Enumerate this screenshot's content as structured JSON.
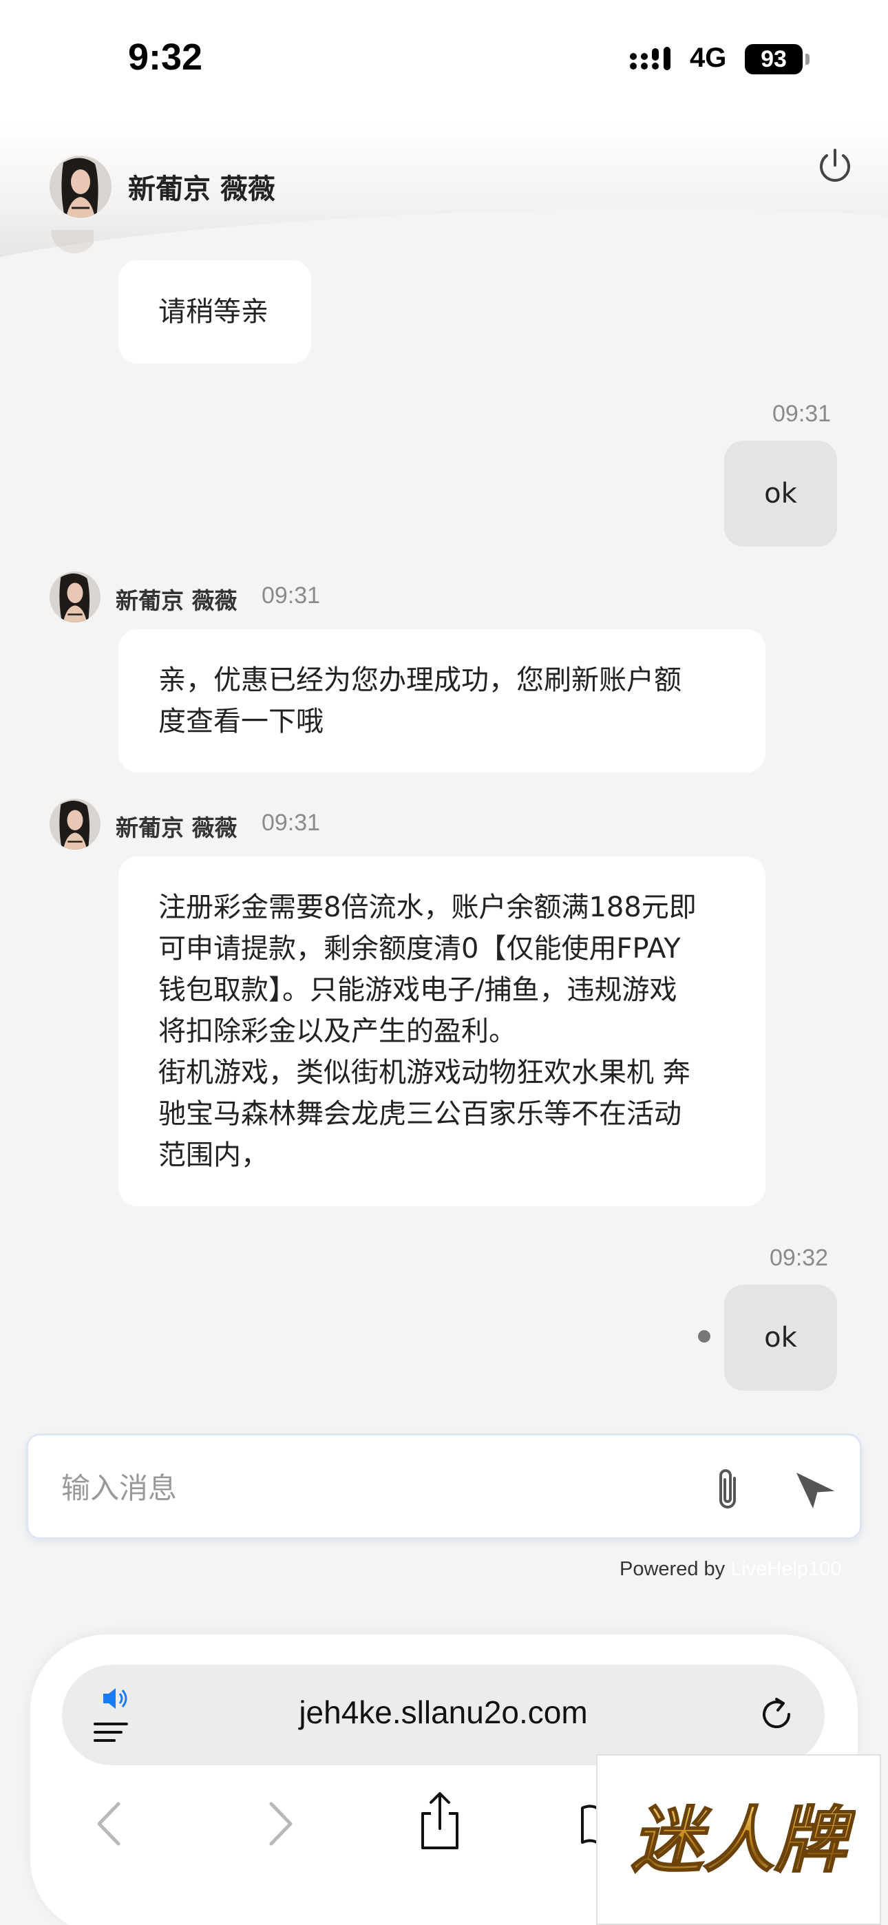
{
  "status_bar": {
    "time": "9:32",
    "network": "4G",
    "battery": "93"
  },
  "header": {
    "title": "新葡京 薇薇",
    "avatar_icon": "avatar-icon",
    "power_icon": "power-icon"
  },
  "messages": [
    {
      "direction": "in",
      "text": "请稍等亲"
    },
    {
      "direction": "out",
      "time": "09:31",
      "text": "ok"
    },
    {
      "direction": "in",
      "sender": "新葡京 薇薇",
      "time": "09:31",
      "lines": [
        "亲，优惠已经为您办理成功，您刷新账户额",
        "度查看一下哦"
      ]
    },
    {
      "direction": "in",
      "sender": "新葡京 薇薇",
      "time": "09:31",
      "lines": [
        "注册彩金需要8倍流水，账户余额满188元即",
        "可申请提款，剩余额度清0【仅能使用FPAY",
        "钱包取款】。只能游戏电子/捕鱼，违规游戏",
        "将扣除彩金以及产生的盈利。",
        "街机游戏，类似街机游戏动物狂欢水果机 奔",
        "驰宝马森林舞会龙虎三公百家乐等不在活动",
        "范围内，"
      ]
    },
    {
      "direction": "out",
      "time": "09:32",
      "text": "ok"
    }
  ],
  "composer": {
    "placeholder": "输入消息",
    "attach_icon": "paperclip-icon",
    "send_icon": "send-icon"
  },
  "footer": {
    "powered_prefix": "Powered by",
    "powered_brand": "LiveHelp100"
  },
  "browser": {
    "url": "jeh4ke.sllanu2o.com"
  },
  "watermark": {
    "text": "迷人牌"
  },
  "colors": {
    "incoming_bubble": "#ffffff",
    "outgoing_bubble": "#e4e4e4",
    "background": "#f4f4f4"
  }
}
